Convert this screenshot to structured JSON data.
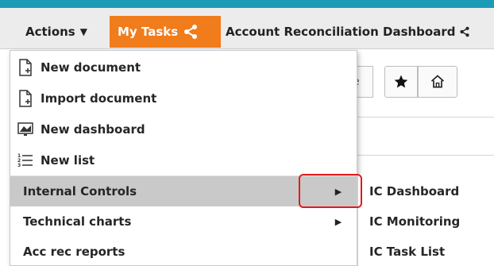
{
  "colors": {
    "accent": "#1b9bb5",
    "tab_active": "#f07c1b",
    "highlight": "#c9c9c9",
    "callout": "#e11b1b"
  },
  "tabs": {
    "actions_label": "Actions",
    "actions_caret": "▼",
    "mytasks_label": "My Tasks",
    "dashboard_label": "Account Reconciliation Dashboard"
  },
  "toolbar": {
    "partial_button_label": "e",
    "star_icon": "star-icon",
    "home_icon": "home-icon"
  },
  "menu": {
    "items": [
      {
        "label": "New document",
        "icon": "new-document-icon"
      },
      {
        "label": "Import document",
        "icon": "import-document-icon"
      },
      {
        "label": "New dashboard",
        "icon": "dashboard-icon"
      },
      {
        "label": "New list",
        "icon": "list-icon"
      },
      {
        "label": "Internal Controls",
        "submenu": true,
        "highlighted": true
      },
      {
        "label": "Technical charts",
        "submenu": true
      },
      {
        "label": "Acc rec reports"
      }
    ]
  },
  "submenu": {
    "items": [
      {
        "label": "IC Dashboard"
      },
      {
        "label": "IC Monitoring"
      },
      {
        "label": "IC Task List"
      }
    ]
  }
}
